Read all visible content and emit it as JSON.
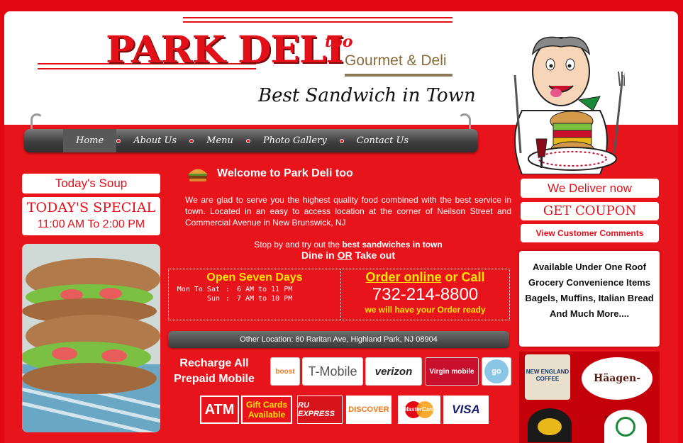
{
  "header": {
    "logo_main": "PARK DELI",
    "logo_suffix": "too",
    "logo_sub": "Gourmet & Deli",
    "tagline": "Best Sandwich in Town"
  },
  "nav": {
    "items": [
      "Home",
      "About Us",
      "Menu",
      "Photo Gallery",
      "Contact Us"
    ],
    "active": "Home"
  },
  "left": {
    "soup_label": "Today's Soup",
    "special_title": "TODAY'S SPECIAL",
    "special_hours": "11:00 AM To 2:00 PM"
  },
  "main": {
    "welcome": "Welcome to Park Deli too",
    "intro": "We are glad to serve you the highest quality food combined with the best service in town. Located in an easy to access location at the corner of Neilson Street and Commercial Avenue in New Brunswick, NJ",
    "stopby_prefix": "Stop by and try out the ",
    "stopby_bold": "best sandwiches in town",
    "dine_a": "Dine in ",
    "dine_or": "OR",
    "dine_b": " Take out",
    "open_title": "Open Seven Days",
    "hours": [
      {
        "day": "Mon To Sat",
        "time": "6 AM to 11 PM"
      },
      {
        "day": "Sun",
        "time": "7 AM to 10 PM"
      }
    ],
    "order_link": "Order online",
    "order_rest": " or Call",
    "phone": "732-214-8800",
    "ready": "we will have your Order ready",
    "other_location": "Other Location: 80 Raritan Ave, Highland Park, NJ 08904",
    "recharge": "Recharge All Prepaid Mobile",
    "carriers": [
      "boost",
      "T-Mobile",
      "verizon",
      "Virgin mobile",
      "go"
    ],
    "payments": [
      "ATM",
      "Gift Cards Available",
      "RU EXPRESS",
      "DISCOVER",
      "MasterCard",
      "VISA"
    ]
  },
  "right": {
    "deliver": "We Deliver now",
    "coupon": "GET COUPON",
    "comments": "View Customer Comments",
    "grocery": "Available Under One Roof Grocery Convenience Items Bagels, Muffins, Italian Bread And Much More....",
    "brands": [
      "NEW ENGLAND COFFEE",
      "Häagen-Dazs"
    ]
  },
  "colors": {
    "brand_red": "#e3101a",
    "accent_yellow": "#ffe400"
  }
}
